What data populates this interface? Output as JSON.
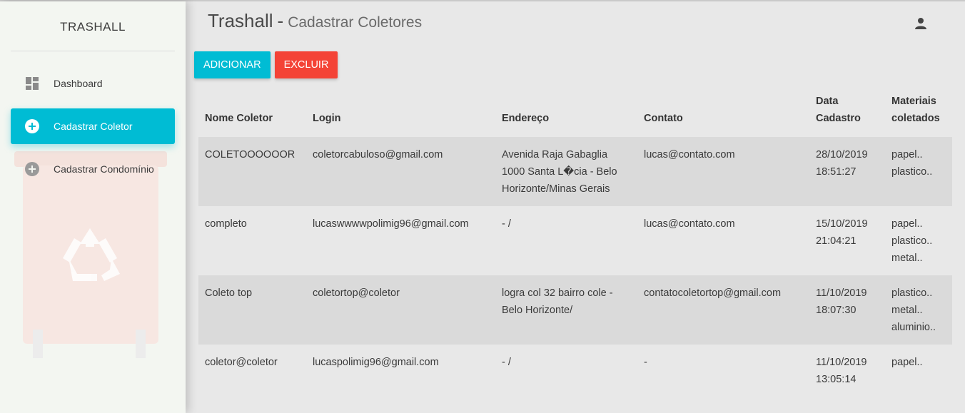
{
  "sidebar": {
    "brand": "TRASHALL",
    "items": [
      {
        "label": "Dashboard",
        "icon": "dashboard-icon",
        "active": false
      },
      {
        "label": "Cadastrar Coletor",
        "icon": "add-circle-icon",
        "active": true
      },
      {
        "label": "Cadastrar Condomínio",
        "icon": "add-circle-icon",
        "active": false
      }
    ]
  },
  "header": {
    "title": "Trashall",
    "separator": "-",
    "subtitle": "Cadastrar Coletores",
    "user_icon": "person-icon"
  },
  "toolbar": {
    "add_label": "ADICIONAR",
    "delete_label": "EXCLUIR"
  },
  "colors": {
    "accent": "#00bcd4",
    "danger": "#f44336"
  },
  "table": {
    "headers": [
      "Nome Coletor",
      "Login",
      "Endereço",
      "Contato",
      "Data Cadastro",
      "Materiais coletados"
    ],
    "rows": [
      {
        "nome": "COLETOOOOOOR",
        "login": "coletorcabuloso@gmail.com",
        "endereco": "Avenida Raja Gabaglia 1000 Santa L�cia - Belo Horizonte/Minas Gerais",
        "contato": "lucas@contato.com",
        "data": "28/10/2019 18:51:27",
        "materiais": [
          "papel..",
          "plastico.."
        ]
      },
      {
        "nome": "completo",
        "login": "lucaswwwwpolimig96@gmail.com",
        "endereco": "- /",
        "contato": "lucas@contato.com",
        "data": "15/10/2019 21:04:21",
        "materiais": [
          "papel..",
          "plastico..",
          "metal.."
        ]
      },
      {
        "nome": "Coleto top",
        "login": "coletortop@coletor",
        "endereco": "logra col 32 bairro cole - Belo Horizonte/",
        "contato": "contatocoletortop@gmail.com",
        "data": "11/10/2019 18:07:30",
        "materiais": [
          "plastico..",
          "metal..",
          "aluminio.."
        ]
      },
      {
        "nome": "coletor@coletor",
        "login": "lucaspolimig96@gmail.com",
        "endereco": "- /",
        "contato": "-",
        "data": "11/10/2019 13:05:14",
        "materiais": [
          "papel.."
        ]
      }
    ]
  }
}
